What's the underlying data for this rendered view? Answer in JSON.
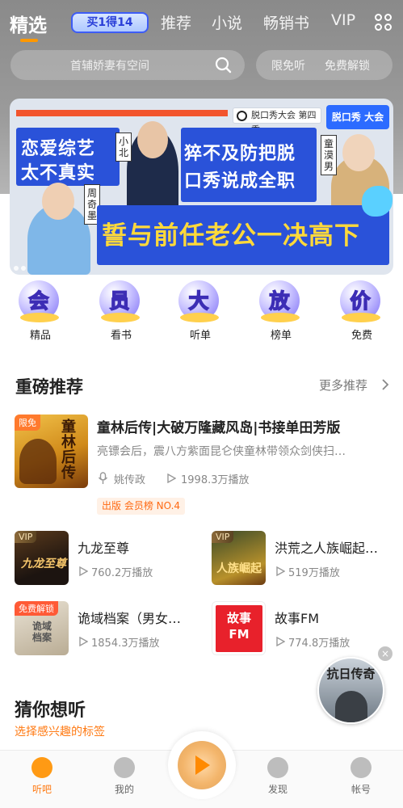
{
  "header": {
    "tabs": [
      {
        "label": "精选",
        "active": true
      },
      {
        "label": "推荐"
      },
      {
        "label": "小说"
      },
      {
        "label": "畅销书"
      },
      {
        "label": "VIP"
      }
    ],
    "promo_badge": "买1得14",
    "accent": "#ff9800"
  },
  "search": {
    "placeholder": "首辅娇妻有空间",
    "quick_links": [
      "限免听",
      "免费解锁"
    ]
  },
  "banner": {
    "logo_text": "脱口秀大会 第四季",
    "logo_text_2": "脱口秀 大会",
    "headline_1": "恋爱综艺",
    "headline_2": "太不真实",
    "headline_3": "猝不及防把脱",
    "headline_4": "口秀说成全职",
    "headline_main": "誓与前任老公一决高下",
    "names": [
      "小北",
      "童漠男",
      "周奇墨"
    ]
  },
  "categories": [
    {
      "glyph": "会",
      "label": "精品"
    },
    {
      "glyph": "员",
      "label": "看书"
    },
    {
      "glyph": "大",
      "label": "听单"
    },
    {
      "glyph": "放",
      "label": "榜单"
    },
    {
      "glyph": "价",
      "label": "免费"
    }
  ],
  "featured_section": {
    "title": "重磅推荐",
    "more_label": "更多推荐",
    "main": {
      "tag": "限免",
      "cover_text": "童林后传",
      "title": "童林后传|大破万隆藏风岛|书接单田芳版",
      "description": "亮镖会后，震八方紫面昆仑侠童林带领众剑侠扫…",
      "host": "姚传政",
      "plays": "1998.3万播放",
      "rank": "出版 会员榜 NO.4"
    },
    "items": [
      {
        "badge": "VIP",
        "cover_text": "九龙至尊",
        "title": "九龙至尊",
        "plays": "760.2万播放"
      },
      {
        "badge": "VIP",
        "cover_text": "人族崛起",
        "title": "洪荒之人族崛起…",
        "plays": "519万播放"
      },
      {
        "badge": "免费解锁",
        "cover_text": "诡域档案",
        "title": "诡域档案（男女…",
        "plays": "1854.3万播放"
      },
      {
        "badge": "",
        "cover_text": "故事 FM",
        "title": "故事FM",
        "plays": "774.8万播放"
      }
    ]
  },
  "guess_section": {
    "title": "猜你想听",
    "subtitle": "选择感兴趣的标签"
  },
  "float_ad": {
    "text": "抗日传奇",
    "close_glyph": "×"
  },
  "bottom_nav": [
    {
      "label": "听吧",
      "active": true
    },
    {
      "label": "我的"
    },
    {
      "label": "发现"
    },
    {
      "label": "帐号"
    }
  ]
}
